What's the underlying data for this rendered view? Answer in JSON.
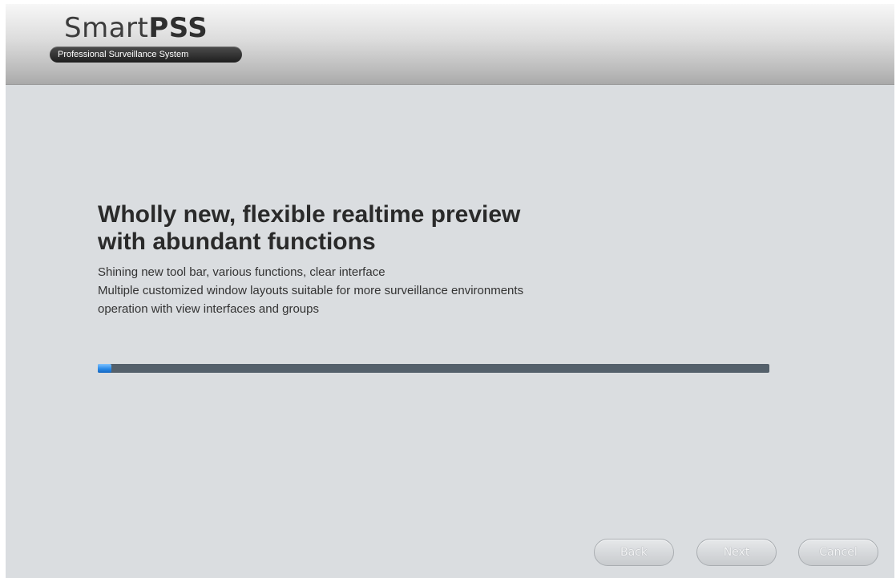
{
  "header": {
    "logo_text_light": "Smart",
    "logo_text_bold": "PSS",
    "tagline": "Professional Surveillance System"
  },
  "main": {
    "headline_line1": "Wholly new, flexible realtime preview",
    "headline_line2": "with abundant functions",
    "features": [
      "Shining new tool bar, various functions, clear interface",
      "Multiple customized window layouts suitable for more surveillance environments",
      "operation with view interfaces and groups"
    ],
    "progress_fraction": 0.02
  },
  "footer": {
    "back_label": "Back",
    "next_label": "Next",
    "cancel_label": "Cancel"
  },
  "colors": {
    "background": "#dadde0",
    "progress_track": "#54606b",
    "progress_fill": "#2a8ae8"
  }
}
